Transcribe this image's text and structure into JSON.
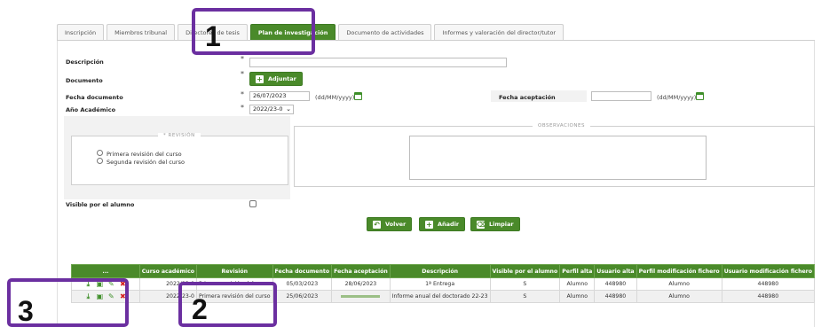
{
  "tabs": [
    {
      "label": "Inscripción",
      "active": false
    },
    {
      "label": "Miembros tribunal",
      "active": false
    },
    {
      "label": "Directores de tesis",
      "active": false
    },
    {
      "label": "Plan de investigación",
      "active": true
    },
    {
      "label": "Documento de actividades",
      "active": false
    },
    {
      "label": "Informes y valoración del director/tutor",
      "active": false
    }
  ],
  "form": {
    "descripcion_label": "Descripción",
    "documento_label": "Documento",
    "adjuntar_label": "Adjuntar",
    "fecha_documento_label": "Fecha documento",
    "fecha_documento_value": "26/07/2023",
    "date_hint": "(dd/MM/yyyy)",
    "fecha_aceptacion_label": "Fecha aceptación",
    "fecha_aceptacion_value": "",
    "anio_label": "Año Académico",
    "anio_value": "2022/23-0",
    "required_mark": "*",
    "revision_legend": "* REVISIÓN",
    "revision_options": [
      "Primera revisión del curso",
      "Segunda revisión del curso"
    ],
    "observaciones_legend": "OBSERVACIONES",
    "visible_label": "Visible por el alumno"
  },
  "actions": {
    "volver": "Volver",
    "anadir": "Añadir",
    "limpiar": "Limpiar"
  },
  "table": {
    "headers": [
      "...",
      "Curso académico",
      "Revisión",
      "Fecha documento",
      "Fecha aceptación",
      "Descripción",
      "Visible por el alumno",
      "Perfil alta",
      "Usuario alta",
      "Perfil modificación fichero",
      "Usuario modificación fichero"
    ],
    "rows": [
      {
        "curso": "2022/23-0",
        "revision": "Primera revisión del curso",
        "fecha_documento": "05/03/2023",
        "fecha_aceptacion": "28/06/2023",
        "descripcion": "1ª Entrega",
        "visible": "S",
        "perfil_alta": "Alumno",
        "usuario_alta": "448980",
        "perfil_mod": "Alumno",
        "usuario_mod": "448980"
      },
      {
        "curso": "2022/23-0",
        "revision": "Primera revisión del curso",
        "fecha_documento": "25/06/2023",
        "fecha_aceptacion": "",
        "descripcion": "Informe anual del doctorado 22-23",
        "visible": "S",
        "perfil_alta": "Alumno",
        "usuario_alta": "448980",
        "perfil_mod": "Alumno",
        "usuario_mod": "448980"
      }
    ]
  },
  "icons": {
    "download": "download-icon",
    "folder": "folder-icon",
    "edit": "edit-icon",
    "delete": "delete-icon"
  },
  "callouts": [
    "1",
    "2",
    "3"
  ],
  "colors": {
    "accent": "#4a8a2a",
    "callout": "#6b2fa0",
    "delete": "#d42020"
  }
}
